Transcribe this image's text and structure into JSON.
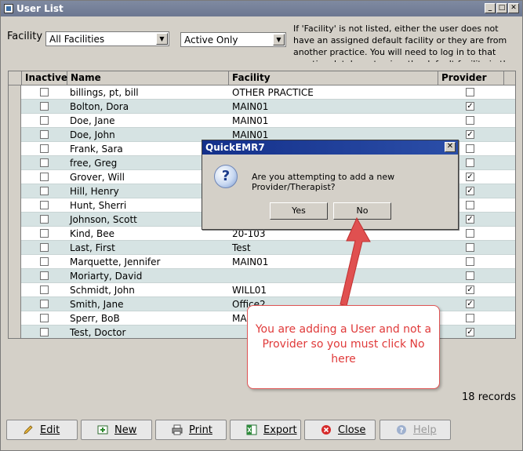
{
  "window": {
    "title": "User List"
  },
  "filters": {
    "facility_label": "Facility",
    "facility_value": "All Facilities",
    "status_value": "Active Only",
    "note": "If 'Facility' is not listed, either the user does not have an assigned default facility or they are from another practice. You will need to log in to that practice database to view the default facility in the list."
  },
  "grid": {
    "columns": [
      "Inactive",
      "Name",
      "Facility",
      "Provider"
    ],
    "rows": [
      {
        "inactive": false,
        "name": "billings, pt, bill",
        "facility": "OTHER PRACTICE",
        "provider": false
      },
      {
        "inactive": false,
        "name": "Bolton, Dora",
        "facility": "MAIN01",
        "provider": true
      },
      {
        "inactive": false,
        "name": "Doe, Jane",
        "facility": "MAIN01",
        "provider": false
      },
      {
        "inactive": false,
        "name": "Doe, John",
        "facility": "MAIN01",
        "provider": true
      },
      {
        "inactive": false,
        "name": "Frank, Sara",
        "facility": "",
        "provider": false
      },
      {
        "inactive": false,
        "name": "free, Greg",
        "facility": "",
        "provider": false
      },
      {
        "inactive": false,
        "name": "Grover, Will",
        "facility": "",
        "provider": true
      },
      {
        "inactive": false,
        "name": "Hill, Henry",
        "facility": "",
        "provider": true
      },
      {
        "inactive": false,
        "name": "Hunt, Sherri",
        "facility": "",
        "provider": false
      },
      {
        "inactive": false,
        "name": "Johnson, Scott",
        "facility": "",
        "provider": true
      },
      {
        "inactive": false,
        "name": "Kind, Bee",
        "facility": "20-103",
        "provider": false
      },
      {
        "inactive": false,
        "name": "Last, First",
        "facility": "Test",
        "provider": false
      },
      {
        "inactive": false,
        "name": "Marquette, Jennifer",
        "facility": "MAIN01",
        "provider": false
      },
      {
        "inactive": false,
        "name": "Moriarty, David",
        "facility": "",
        "provider": false
      },
      {
        "inactive": false,
        "name": "Schmidt, John",
        "facility": "WILL01",
        "provider": true
      },
      {
        "inactive": false,
        "name": "Smith, Jane",
        "facility": "Office2",
        "provider": true
      },
      {
        "inactive": false,
        "name": "Sperr, BoB",
        "facility": "MA",
        "provider": false
      },
      {
        "inactive": false,
        "name": "Test, Doctor",
        "facility": "",
        "provider": true
      }
    ],
    "check_mark": "✓"
  },
  "records_text": "18 records",
  "buttons": {
    "edit": "Edit",
    "new": "New",
    "print": "Print",
    "export": "Export",
    "close": "Close",
    "help": "Help"
  },
  "dialog": {
    "title": "QuickEMR7",
    "message": "Are you attempting to add a new Provider/Therapist?",
    "yes": "Yes",
    "no": "No",
    "close_glyph": "✕",
    "question_glyph": "?"
  },
  "callout": {
    "text": "You are adding a User and not a Provider so you must click No here"
  },
  "colors": {
    "accent": "#e03a3a",
    "row_alt": "#d6e3e3",
    "title_bar": "#0a246a"
  }
}
